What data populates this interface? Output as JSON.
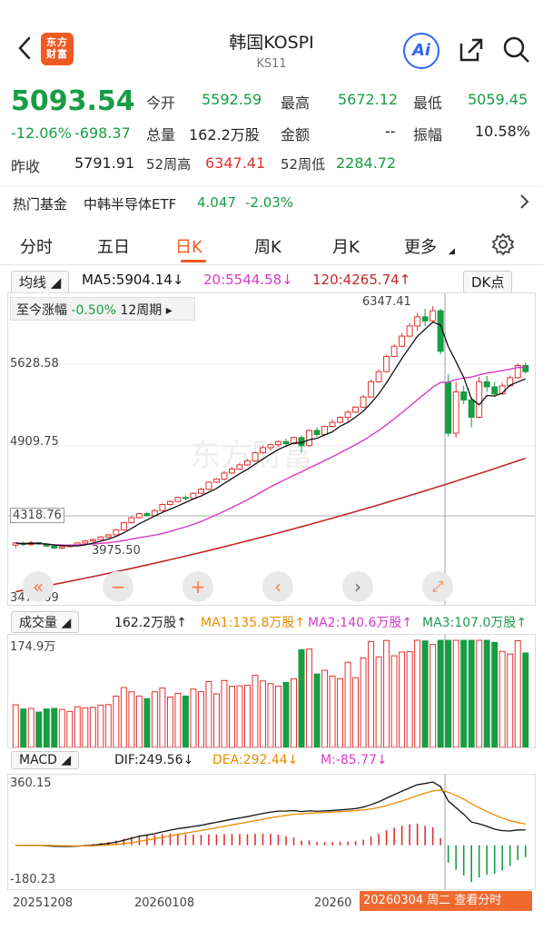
{
  "header": {
    "title": "韩国KOSPI",
    "subtitle": "KS11",
    "logo_text": "东方财富",
    "ai_label": "Ai"
  },
  "quote": {
    "price": "5093.54",
    "change_pct": "-12.06%",
    "change": "-698.37",
    "prev_close_label": "昨收",
    "prev_close": "5791.91",
    "open_label": "今开",
    "open": "5592.59",
    "high_label": "最高",
    "high": "5672.12",
    "low_label": "最低",
    "low": "5059.45",
    "volume_label": "总量",
    "volume": "162.2万股",
    "amount_label": "金额",
    "amount": "--",
    "amplitude_label": "振幅",
    "amplitude": "10.58%",
    "wk52_high_label": "52周高",
    "wk52_high": "6347.41",
    "wk52_low_label": "52周低",
    "wk52_low": "2284.72"
  },
  "hot_fund": {
    "label": "热门基金",
    "name": "中韩半导体ETF",
    "price": "4.047",
    "change": "-2.03%"
  },
  "tabs": [
    {
      "label": "分时"
    },
    {
      "label": "五日"
    },
    {
      "label": "日K"
    },
    {
      "label": "周K"
    },
    {
      "label": "月K"
    },
    {
      "label": "更多"
    }
  ],
  "ma_row": {
    "type_label": "均线",
    "ma5": "MA5:5904.14↓",
    "ma20": "20:5544.58↓",
    "ma120": "120:4265.74↑",
    "dk_label": "DK点"
  },
  "range_info": {
    "label": "至今涨幅",
    "value": "-0.50%",
    "period": "12周期"
  },
  "price_axis": {
    "high": "5628.58",
    "mid": "4909.75",
    "low": "3472.09",
    "crosshair": "4318.76",
    "max_marker": "6347.41",
    "min_marker": "3975.50"
  },
  "volume_row": {
    "label": "成交量",
    "vol": "162.2万股↑",
    "ma1": "MA1:135.8万股↑",
    "ma2": "MA2:140.6万股↑",
    "ma3": "MA3:107.0万股↑",
    "axis_top": "174.9万"
  },
  "macd_row": {
    "label": "MACD",
    "dif": "DIF:249.56↓",
    "dea": "DEA:292.44↓",
    "m": "M:-85.77↓",
    "axis_top": "360.15",
    "axis_bottom": "-180.23"
  },
  "date_axis": [
    "20251208",
    "20260108",
    "20260"
  ],
  "tooltip": "20260304 周二  查看分时",
  "watermark": "东方财富",
  "colors": {
    "up": "#e0312e",
    "down": "#179d44",
    "ma5": "#111111",
    "ma20": "#d63ac9",
    "ma120": "#c0282a",
    "accent": "#f05a22"
  },
  "chart_data": {
    "type": "candlestick",
    "candles": [
      [
        3990,
        4010,
        3960,
        4020
      ],
      [
        4010,
        3995,
        3980,
        4025
      ],
      [
        3995,
        4015,
        3985,
        4030
      ],
      [
        4015,
        4000,
        3990,
        4022
      ],
      [
        4000,
        3980,
        3970,
        4010
      ],
      [
        3980,
        3960,
        3950,
        3990
      ],
      [
        3960,
        3975,
        3950,
        3985
      ],
      [
        3975,
        3985,
        3968,
        3995
      ],
      [
        3985,
        4010,
        3980,
        4020
      ],
      [
        4010,
        4030,
        4005,
        4040
      ],
      [
        4030,
        4045,
        4020,
        4055
      ],
      [
        4045,
        4070,
        4040,
        4080
      ],
      [
        4070,
        4090,
        4060,
        4100
      ],
      [
        4090,
        4140,
        4085,
        4150
      ],
      [
        4140,
        4210,
        4130,
        4220
      ],
      [
        4210,
        4260,
        4200,
        4275
      ],
      [
        4260,
        4300,
        4250,
        4310
      ],
      [
        4300,
        4280,
        4270,
        4320
      ],
      [
        4280,
        4330,
        4275,
        4345
      ],
      [
        4330,
        4390,
        4320,
        4400
      ],
      [
        4390,
        4420,
        4380,
        4430
      ],
      [
        4420,
        4460,
        4410,
        4470
      ],
      [
        4460,
        4450,
        4430,
        4480
      ],
      [
        4450,
        4500,
        4440,
        4510
      ],
      [
        4500,
        4540,
        4495,
        4555
      ],
      [
        4540,
        4610,
        4530,
        4620
      ],
      [
        4610,
        4640,
        4600,
        4650
      ],
      [
        4640,
        4700,
        4630,
        4720
      ],
      [
        4700,
        4740,
        4690,
        4760
      ],
      [
        4740,
        4780,
        4730,
        4800
      ],
      [
        4780,
        4820,
        4770,
        4840
      ],
      [
        4820,
        4900,
        4810,
        4910
      ],
      [
        4900,
        4950,
        4890,
        4970
      ],
      [
        4950,
        4980,
        4920,
        4990
      ],
      [
        4980,
        5010,
        4960,
        5020
      ],
      [
        5010,
        4990,
        4970,
        5040
      ],
      [
        4990,
        5050,
        4980,
        5060
      ],
      [
        5050,
        4970,
        4900,
        5070
      ],
      [
        4970,
        5120,
        4960,
        5130
      ],
      [
        5120,
        5080,
        5060,
        5150
      ],
      [
        5080,
        5160,
        5070,
        5170
      ],
      [
        5160,
        5200,
        5150,
        5230
      ],
      [
        5200,
        5250,
        5190,
        5260
      ],
      [
        5250,
        5300,
        5200,
        5320
      ],
      [
        5300,
        5350,
        5290,
        5360
      ],
      [
        5350,
        5450,
        5340,
        5470
      ],
      [
        5450,
        5600,
        5440,
        5620
      ],
      [
        5600,
        5700,
        5590,
        5720
      ],
      [
        5700,
        5850,
        5690,
        5870
      ],
      [
        5850,
        5950,
        5840,
        5970
      ],
      [
        5950,
        6050,
        5940,
        6080
      ],
      [
        6050,
        6150,
        6040,
        6180
      ],
      [
        6150,
        6240,
        6100,
        6280
      ],
      [
        6240,
        6200,
        6150,
        6320
      ],
      [
        6200,
        6300,
        6190,
        6347
      ],
      [
        6300,
        5900,
        5870,
        6320
      ],
      [
        5592,
        5093,
        5059,
        5672
      ],
      [
        5093,
        5500,
        5050,
        5600
      ],
      [
        5500,
        5420,
        5380,
        5560
      ],
      [
        5420,
        5250,
        5150,
        5450
      ],
      [
        5250,
        5600,
        5240,
        5650
      ],
      [
        5600,
        5550,
        5500,
        5660
      ],
      [
        5550,
        5480,
        5450,
        5600
      ],
      [
        5480,
        5560,
        5470,
        5590
      ],
      [
        5560,
        5640,
        5550,
        5660
      ],
      [
        5640,
        5760,
        5630,
        5780
      ],
      [
        5760,
        5700,
        5680,
        5790
      ]
    ],
    "ylim": [
      3472.09,
      6400
    ]
  }
}
